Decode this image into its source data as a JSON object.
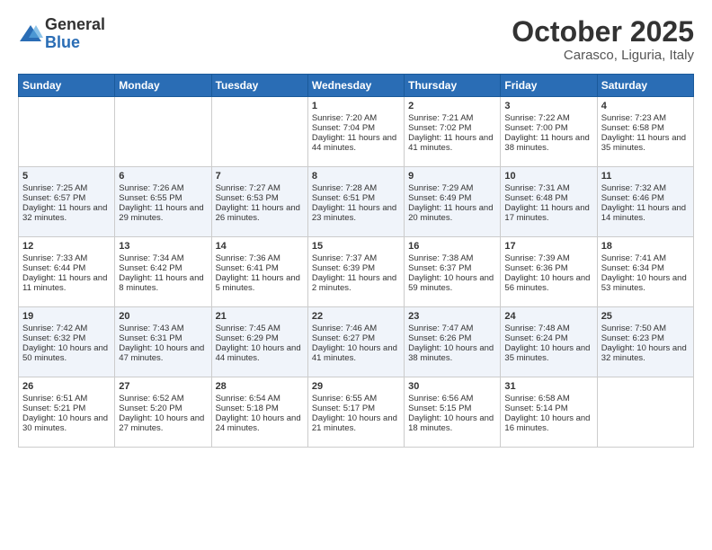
{
  "logo": {
    "general": "General",
    "blue": "Blue"
  },
  "header": {
    "month": "October 2025",
    "location": "Carasco, Liguria, Italy"
  },
  "weekdays": [
    "Sunday",
    "Monday",
    "Tuesday",
    "Wednesday",
    "Thursday",
    "Friday",
    "Saturday"
  ],
  "weeks": [
    [
      {
        "day": "",
        "sunrise": "",
        "sunset": "",
        "daylight": ""
      },
      {
        "day": "",
        "sunrise": "",
        "sunset": "",
        "daylight": ""
      },
      {
        "day": "",
        "sunrise": "",
        "sunset": "",
        "daylight": ""
      },
      {
        "day": "1",
        "sunrise": "Sunrise: 7:20 AM",
        "sunset": "Sunset: 7:04 PM",
        "daylight": "Daylight: 11 hours and 44 minutes."
      },
      {
        "day": "2",
        "sunrise": "Sunrise: 7:21 AM",
        "sunset": "Sunset: 7:02 PM",
        "daylight": "Daylight: 11 hours and 41 minutes."
      },
      {
        "day": "3",
        "sunrise": "Sunrise: 7:22 AM",
        "sunset": "Sunset: 7:00 PM",
        "daylight": "Daylight: 11 hours and 38 minutes."
      },
      {
        "day": "4",
        "sunrise": "Sunrise: 7:23 AM",
        "sunset": "Sunset: 6:58 PM",
        "daylight": "Daylight: 11 hours and 35 minutes."
      }
    ],
    [
      {
        "day": "5",
        "sunrise": "Sunrise: 7:25 AM",
        "sunset": "Sunset: 6:57 PM",
        "daylight": "Daylight: 11 hours and 32 minutes."
      },
      {
        "day": "6",
        "sunrise": "Sunrise: 7:26 AM",
        "sunset": "Sunset: 6:55 PM",
        "daylight": "Daylight: 11 hours and 29 minutes."
      },
      {
        "day": "7",
        "sunrise": "Sunrise: 7:27 AM",
        "sunset": "Sunset: 6:53 PM",
        "daylight": "Daylight: 11 hours and 26 minutes."
      },
      {
        "day": "8",
        "sunrise": "Sunrise: 7:28 AM",
        "sunset": "Sunset: 6:51 PM",
        "daylight": "Daylight: 11 hours and 23 minutes."
      },
      {
        "day": "9",
        "sunrise": "Sunrise: 7:29 AM",
        "sunset": "Sunset: 6:49 PM",
        "daylight": "Daylight: 11 hours and 20 minutes."
      },
      {
        "day": "10",
        "sunrise": "Sunrise: 7:31 AM",
        "sunset": "Sunset: 6:48 PM",
        "daylight": "Daylight: 11 hours and 17 minutes."
      },
      {
        "day": "11",
        "sunrise": "Sunrise: 7:32 AM",
        "sunset": "Sunset: 6:46 PM",
        "daylight": "Daylight: 11 hours and 14 minutes."
      }
    ],
    [
      {
        "day": "12",
        "sunrise": "Sunrise: 7:33 AM",
        "sunset": "Sunset: 6:44 PM",
        "daylight": "Daylight: 11 hours and 11 minutes."
      },
      {
        "day": "13",
        "sunrise": "Sunrise: 7:34 AM",
        "sunset": "Sunset: 6:42 PM",
        "daylight": "Daylight: 11 hours and 8 minutes."
      },
      {
        "day": "14",
        "sunrise": "Sunrise: 7:36 AM",
        "sunset": "Sunset: 6:41 PM",
        "daylight": "Daylight: 11 hours and 5 minutes."
      },
      {
        "day": "15",
        "sunrise": "Sunrise: 7:37 AM",
        "sunset": "Sunset: 6:39 PM",
        "daylight": "Daylight: 11 hours and 2 minutes."
      },
      {
        "day": "16",
        "sunrise": "Sunrise: 7:38 AM",
        "sunset": "Sunset: 6:37 PM",
        "daylight": "Daylight: 10 hours and 59 minutes."
      },
      {
        "day": "17",
        "sunrise": "Sunrise: 7:39 AM",
        "sunset": "Sunset: 6:36 PM",
        "daylight": "Daylight: 10 hours and 56 minutes."
      },
      {
        "day": "18",
        "sunrise": "Sunrise: 7:41 AM",
        "sunset": "Sunset: 6:34 PM",
        "daylight": "Daylight: 10 hours and 53 minutes."
      }
    ],
    [
      {
        "day": "19",
        "sunrise": "Sunrise: 7:42 AM",
        "sunset": "Sunset: 6:32 PM",
        "daylight": "Daylight: 10 hours and 50 minutes."
      },
      {
        "day": "20",
        "sunrise": "Sunrise: 7:43 AM",
        "sunset": "Sunset: 6:31 PM",
        "daylight": "Daylight: 10 hours and 47 minutes."
      },
      {
        "day": "21",
        "sunrise": "Sunrise: 7:45 AM",
        "sunset": "Sunset: 6:29 PM",
        "daylight": "Daylight: 10 hours and 44 minutes."
      },
      {
        "day": "22",
        "sunrise": "Sunrise: 7:46 AM",
        "sunset": "Sunset: 6:27 PM",
        "daylight": "Daylight: 10 hours and 41 minutes."
      },
      {
        "day": "23",
        "sunrise": "Sunrise: 7:47 AM",
        "sunset": "Sunset: 6:26 PM",
        "daylight": "Daylight: 10 hours and 38 minutes."
      },
      {
        "day": "24",
        "sunrise": "Sunrise: 7:48 AM",
        "sunset": "Sunset: 6:24 PM",
        "daylight": "Daylight: 10 hours and 35 minutes."
      },
      {
        "day": "25",
        "sunrise": "Sunrise: 7:50 AM",
        "sunset": "Sunset: 6:23 PM",
        "daylight": "Daylight: 10 hours and 32 minutes."
      }
    ],
    [
      {
        "day": "26",
        "sunrise": "Sunrise: 6:51 AM",
        "sunset": "Sunset: 5:21 PM",
        "daylight": "Daylight: 10 hours and 30 minutes."
      },
      {
        "day": "27",
        "sunrise": "Sunrise: 6:52 AM",
        "sunset": "Sunset: 5:20 PM",
        "daylight": "Daylight: 10 hours and 27 minutes."
      },
      {
        "day": "28",
        "sunrise": "Sunrise: 6:54 AM",
        "sunset": "Sunset: 5:18 PM",
        "daylight": "Daylight: 10 hours and 24 minutes."
      },
      {
        "day": "29",
        "sunrise": "Sunrise: 6:55 AM",
        "sunset": "Sunset: 5:17 PM",
        "daylight": "Daylight: 10 hours and 21 minutes."
      },
      {
        "day": "30",
        "sunrise": "Sunrise: 6:56 AM",
        "sunset": "Sunset: 5:15 PM",
        "daylight": "Daylight: 10 hours and 18 minutes."
      },
      {
        "day": "31",
        "sunrise": "Sunrise: 6:58 AM",
        "sunset": "Sunset: 5:14 PM",
        "daylight": "Daylight: 10 hours and 16 minutes."
      },
      {
        "day": "",
        "sunrise": "",
        "sunset": "",
        "daylight": ""
      }
    ]
  ]
}
